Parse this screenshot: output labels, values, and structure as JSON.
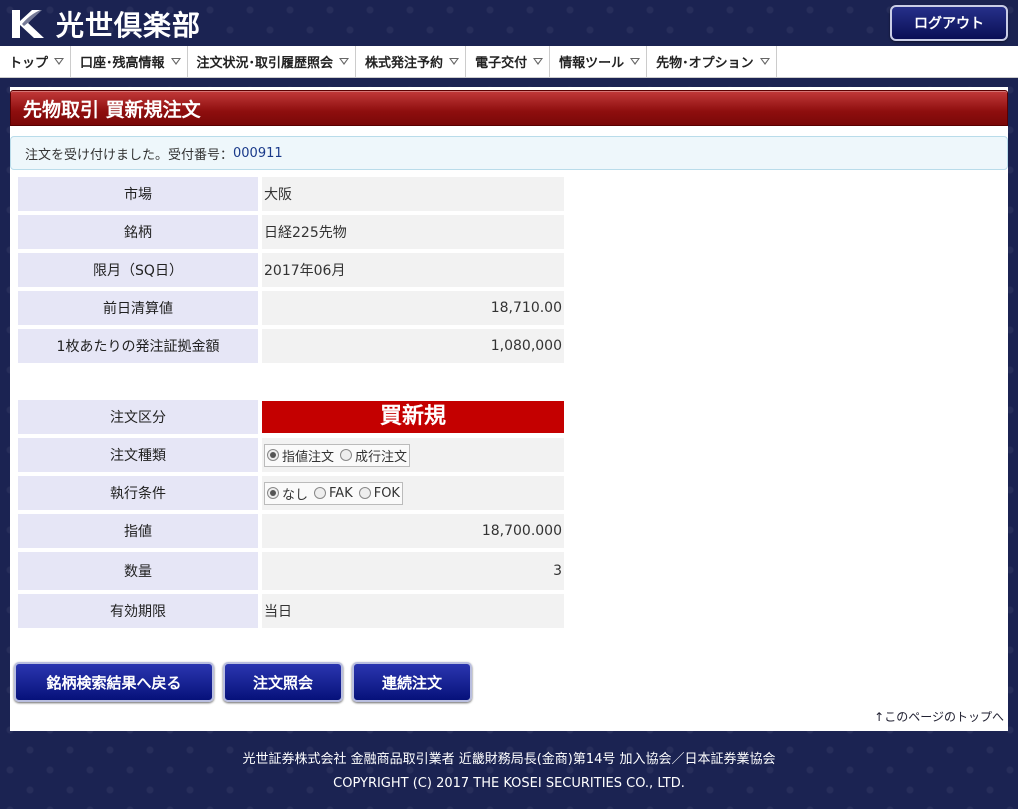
{
  "header": {
    "logo_text": "光世倶楽部",
    "logout_label": "ログアウト"
  },
  "nav": {
    "items": [
      {
        "label": "トップ"
      },
      {
        "label": "口座･残高情報"
      },
      {
        "label": "注文状況･取引履歴照会"
      },
      {
        "label": "株式発注予約"
      },
      {
        "label": "電子交付"
      },
      {
        "label": "情報ツール"
      },
      {
        "label": "先物･オプション"
      }
    ]
  },
  "page": {
    "title": "先物取引  買新規注文",
    "notice_prefix": "注文を受け付けました。受付番号：",
    "receipt_number": "000911"
  },
  "contract_info": {
    "market_label": "市場",
    "market_value": "大阪",
    "issue_label": "銘柄",
    "issue_value": "日経225先物",
    "month_label": "限月（SQ日）",
    "month_value": "2017年06月",
    "settle_label": "前日清算値",
    "settle_value": "18,710.00",
    "margin_label": "1枚あたりの発注証拠金額",
    "margin_value": "1,080,000"
  },
  "order": {
    "type_label": "注文区分",
    "type_value": "買新規",
    "kind_label": "注文種類",
    "kind_options": [
      "指値注文",
      "成行注文"
    ],
    "kind_selected": "指値注文",
    "cond_label": "執行条件",
    "cond_options": [
      "なし",
      "FAK",
      "FOK"
    ],
    "cond_selected": "なし",
    "price_label": "指値",
    "price_value": "18,700.000",
    "qty_label": "数量",
    "qty_value": "3",
    "expiry_label": "有効期限",
    "expiry_value": "当日"
  },
  "buttons": {
    "back": "銘柄検索結果へ戻る",
    "inquiry": "注文照会",
    "continue": "連続注文"
  },
  "page_top_link": "↑このページのトップへ",
  "footer": {
    "line1": "光世証券株式会社  金融商品取引業者  近畿財務局長(金商)第14号  加入協会／日本証券業協会",
    "line2": "COPYRIGHT (C) 2017 THE KOSEI SECURITIES CO., LTD."
  }
}
